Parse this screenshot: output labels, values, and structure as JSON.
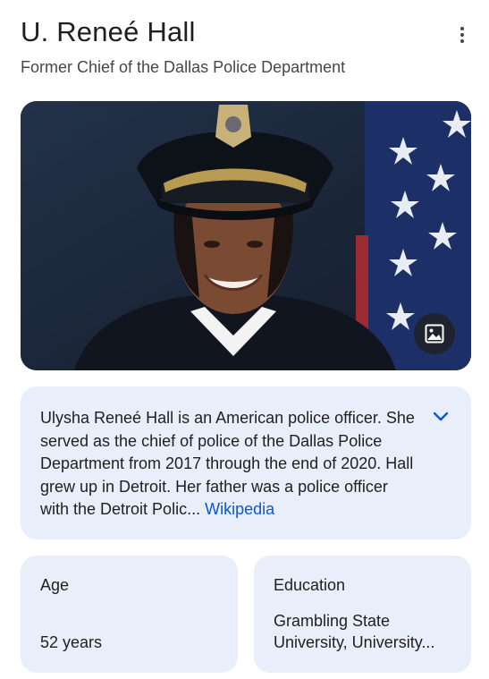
{
  "header": {
    "title": "U. Reneé Hall",
    "subtitle": "Former Chief of the Dallas Police Department",
    "more_icon": "more-vertical-icon"
  },
  "photo": {
    "image_button_icon": "image-icon"
  },
  "description": {
    "text": "Ulysha Reneé Hall is an American police officer. She served as the chief of police of the Dallas Police Department from 2017 through the end of 2020. Hall grew up in Detroit. Her father was a police officer with the Detroit Polic",
    "ellipsis": "... ",
    "source_link": "Wikipedia",
    "expand_icon": "chevron-down-icon"
  },
  "facts": {
    "age": {
      "label": "Age",
      "value": "52 years"
    },
    "education": {
      "label": "Education",
      "value_line1": "Grambling State",
      "value_line2": "University, University..."
    }
  },
  "colors": {
    "card_bg": "#e8eefa",
    "link": "#0b57d0",
    "text": "#1f1f1f"
  }
}
